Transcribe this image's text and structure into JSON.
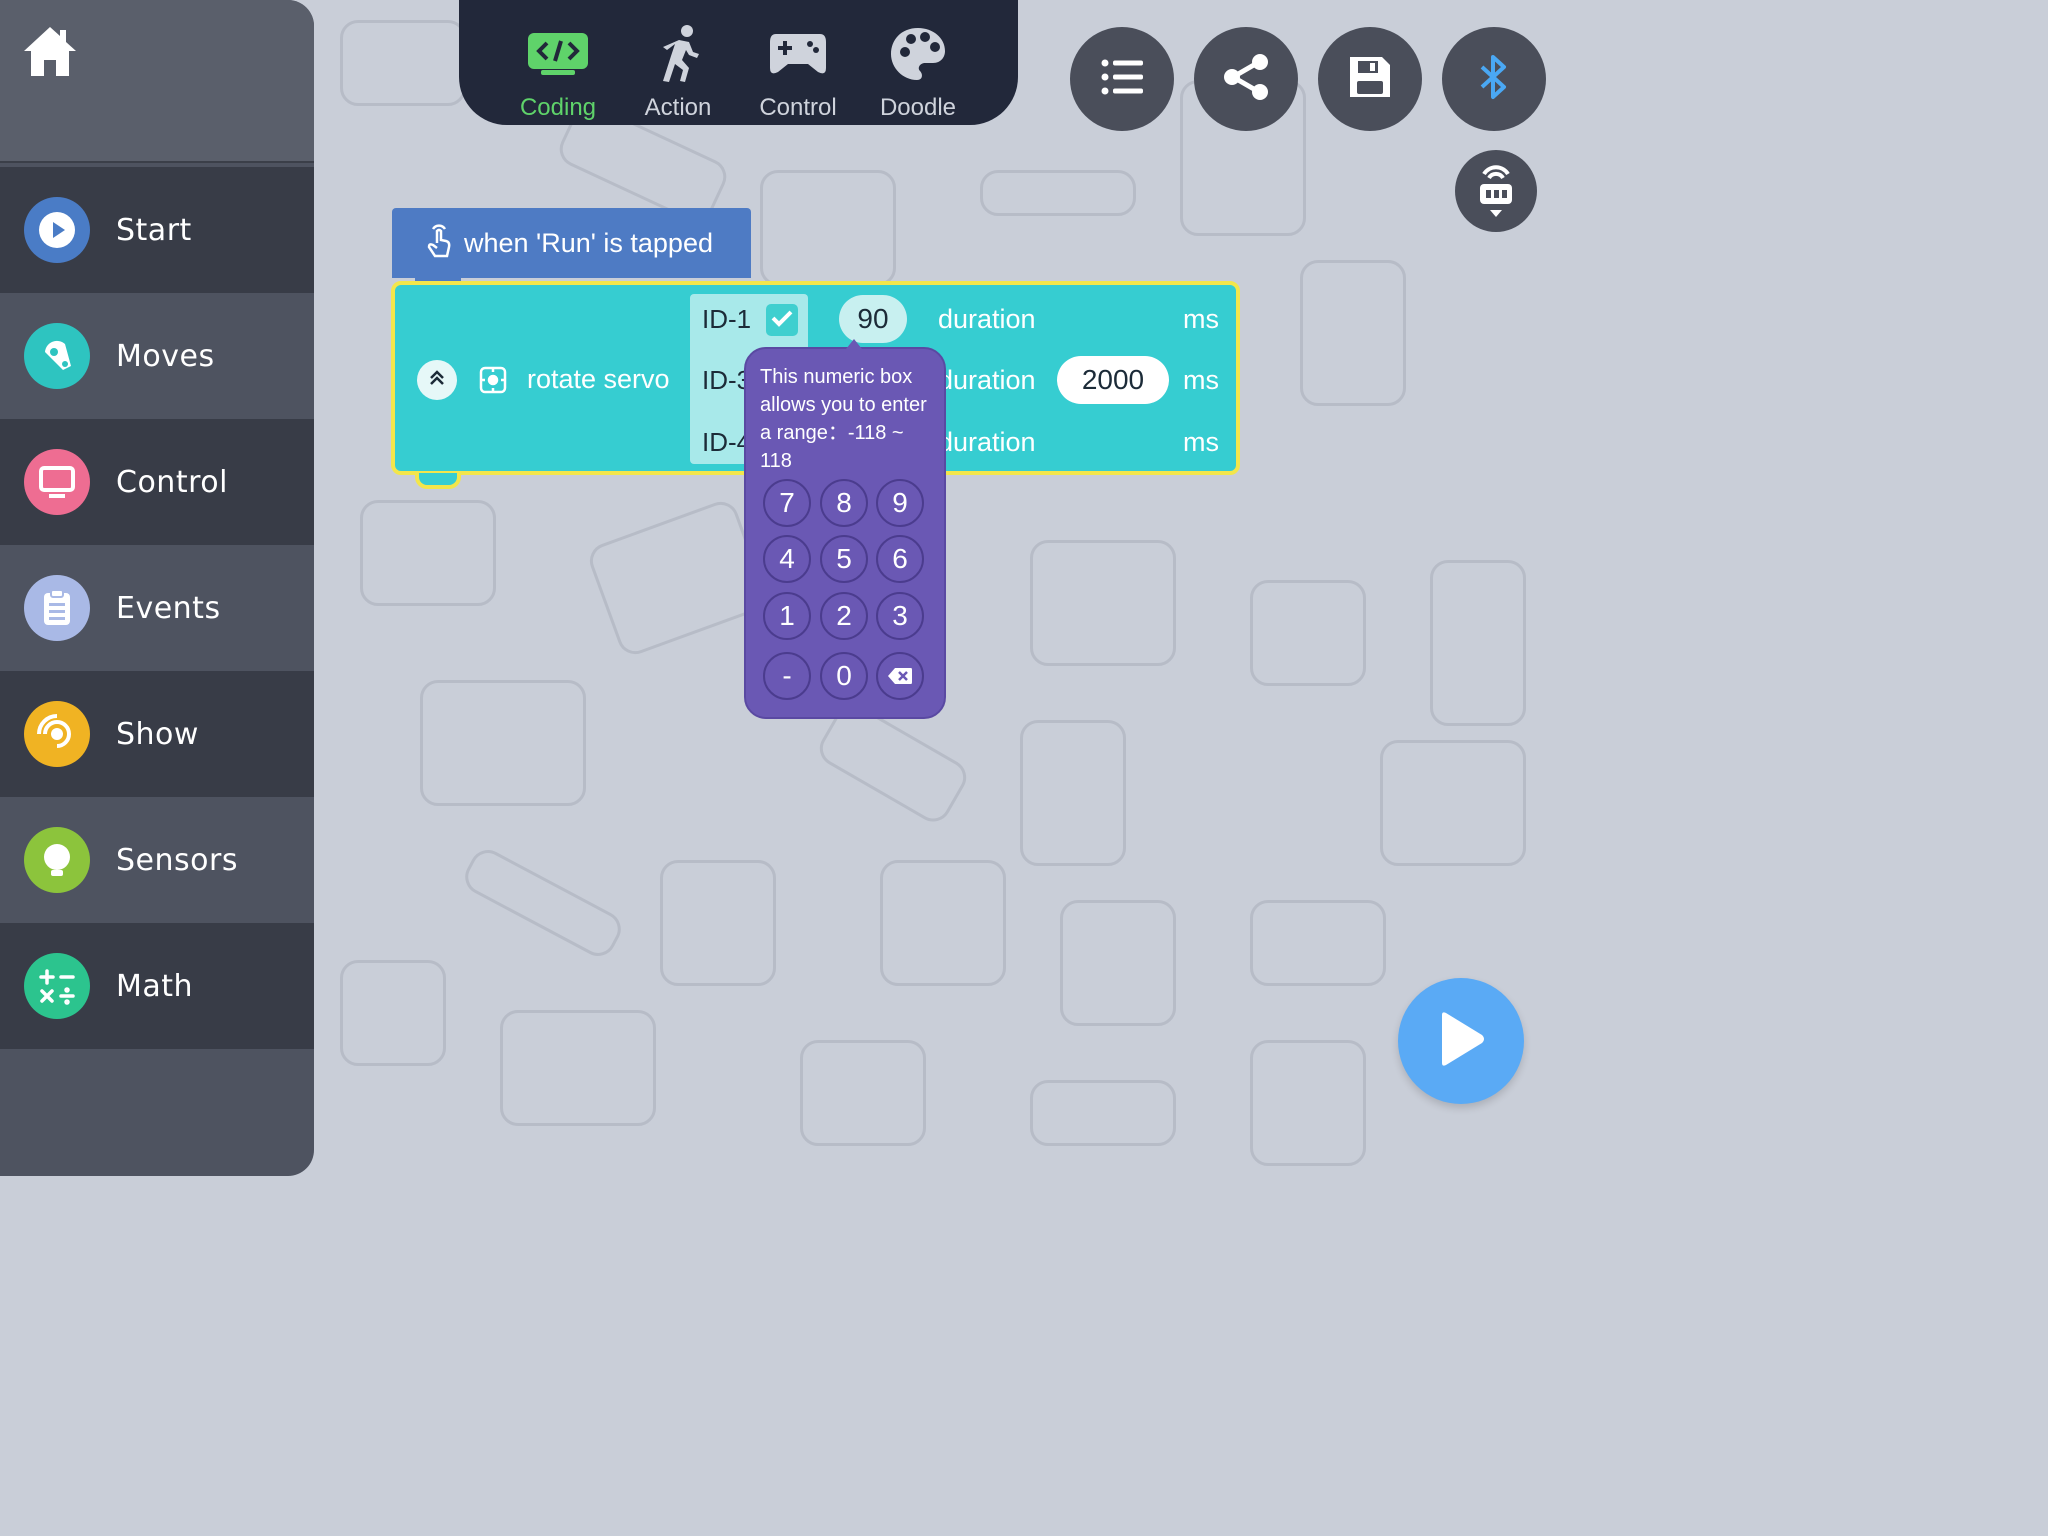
{
  "sidebar": {
    "home_icon": "home-icon",
    "categories": [
      {
        "label": "Start",
        "icon": "play-icon",
        "color": "#4a7cc6"
      },
      {
        "label": "Moves",
        "icon": "servo-icon",
        "color": "#2ec4c0"
      },
      {
        "label": "Control",
        "icon": "monitor-icon",
        "color": "#ee6d92"
      },
      {
        "label": "Events",
        "icon": "clipboard-icon",
        "color": "#a9b9e6"
      },
      {
        "label": "Show",
        "icon": "target-icon",
        "color": "#f0b323"
      },
      {
        "label": "Sensors",
        "icon": "bulb-icon",
        "color": "#8cc43c"
      },
      {
        "label": "Math",
        "icon": "math-icon",
        "color": "#2cc48e"
      }
    ]
  },
  "tabs": [
    {
      "label": "Coding",
      "active": true
    },
    {
      "label": "Action",
      "active": false
    },
    {
      "label": "Control",
      "active": false
    },
    {
      "label": "Doodle",
      "active": false
    }
  ],
  "toolbar": {
    "buttons": [
      "list-icon",
      "share-icon",
      "save-icon",
      "bluetooth-icon"
    ],
    "remote_icon": "remote-lock-icon"
  },
  "blocks": {
    "hat_label": "when 'Run' is tapped",
    "servo_label": "rotate servo",
    "rows": [
      {
        "id": "ID-1",
        "angle": "90",
        "duration_label": "duration",
        "duration": "",
        "unit": "ms"
      },
      {
        "id": "ID-3",
        "angle": "",
        "duration_label": "duration",
        "duration": "2000",
        "unit": "ms"
      },
      {
        "id": "ID-4",
        "angle": "",
        "duration_label": "duration",
        "duration": "",
        "unit": "ms"
      }
    ]
  },
  "numpad": {
    "hint": "This numeric box allows you to enter a range：-118 ~ 118",
    "keys": [
      "7",
      "8",
      "9",
      "4",
      "5",
      "6",
      "1",
      "2",
      "3",
      "-",
      "0"
    ]
  },
  "colors": {
    "accent_green": "#5fd36a",
    "block_teal": "#36cdd1",
    "block_blue": "#4e7bc4",
    "highlight_yellow": "#f3e64b",
    "numpad_purple": "#6a58b4",
    "run_blue": "#5aaaf5"
  }
}
